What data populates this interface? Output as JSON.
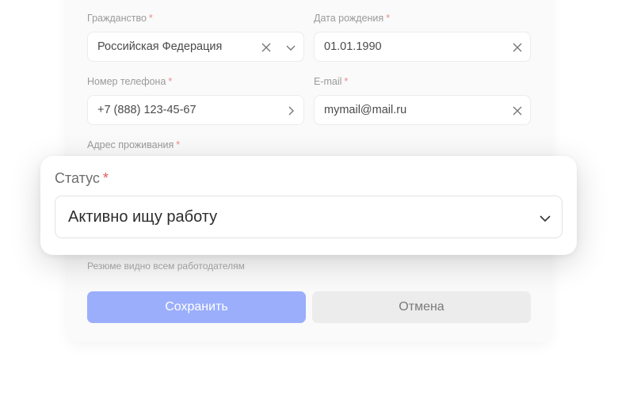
{
  "form": {
    "citizenship": {
      "label": "Гражданство",
      "required": "*",
      "value": "Российская Федерация"
    },
    "birthdate": {
      "label": "Дата рождения",
      "required": "*",
      "value": "01.01.1990"
    },
    "phone": {
      "label": "Номер телефона",
      "required": "*",
      "value": "+7 (888) 123-45-67"
    },
    "email": {
      "label": "E-mail",
      "required": "*",
      "value": "mymail@mail.ru"
    },
    "address": {
      "label": "Адрес проживания",
      "required": "*"
    },
    "visibility_hint": "Резюме видно всем работодателям",
    "save_label": "Сохранить",
    "cancel_label": "Отмена"
  },
  "popup": {
    "status_label": "Статус",
    "required": "*",
    "status_value": "Активно ищу работу"
  },
  "icons": {
    "clear": "close-icon",
    "dropdown": "chevron-down-icon",
    "next": "chevron-right-icon"
  },
  "colors": {
    "primary_button": "#9aaefc",
    "secondary_button": "#ececec",
    "required_marker": "#f08a8a"
  }
}
